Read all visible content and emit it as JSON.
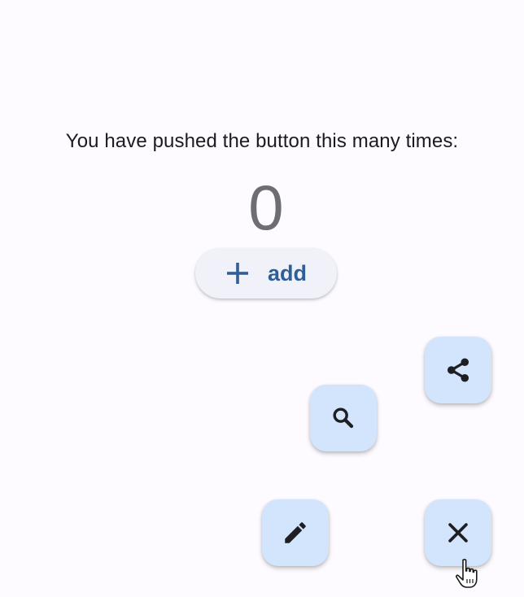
{
  "counter": {
    "label": "You have pushed the button this many times:",
    "value": "0"
  },
  "add_button": {
    "label": "add",
    "icon": "plus-icon"
  },
  "fabs": {
    "share": {
      "icon": "share-icon"
    },
    "search": {
      "icon": "search-icon"
    },
    "edit": {
      "icon": "pencil-icon"
    },
    "close": {
      "icon": "close-icon"
    }
  },
  "colors": {
    "background": "#fdfbff",
    "fab_background": "#d3e4fd",
    "accent": "#2f5f98",
    "text": "#1b1b1f",
    "counter": "#6e6e72"
  }
}
